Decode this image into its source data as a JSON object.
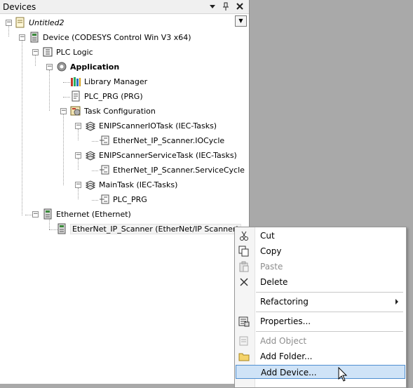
{
  "panel": {
    "title": "Devices",
    "tree": {
      "root": "Untitled2",
      "device": "Device (CODESYS Control Win V3 x64)",
      "plc_logic": "PLC Logic",
      "application": "Application",
      "library_manager": "Library Manager",
      "plc_prg": "PLC_PRG (PRG)",
      "task_configuration": "Task Configuration",
      "enip_io_task": "ENIPScannerIOTask (IEC-Tasks)",
      "io_cycle": "EtherNet_IP_Scanner.IOCycle",
      "enip_service_task": "ENIPScannerServiceTask (IEC-Tasks)",
      "service_cycle": "EtherNet_IP_Scanner.ServiceCycle",
      "main_task": "MainTask (IEC-Tasks)",
      "main_plc_prg": "PLC_PRG",
      "ethernet": "Ethernet (Ethernet)",
      "scanner": "EtherNet_IP_Scanner (EtherNet/IP Scanner)"
    }
  },
  "context_menu": {
    "cut": "Cut",
    "copy": "Copy",
    "paste": "Paste",
    "delete": "Delete",
    "refactoring": "Refactoring",
    "properties": "Properties...",
    "add_object": "Add Object",
    "add_folder": "Add Folder...",
    "add_device": "Add Device..."
  },
  "colors": {
    "background": "#a9a9a9",
    "highlight": "#cfe3f7",
    "highlight_border": "#4f8fd0"
  }
}
